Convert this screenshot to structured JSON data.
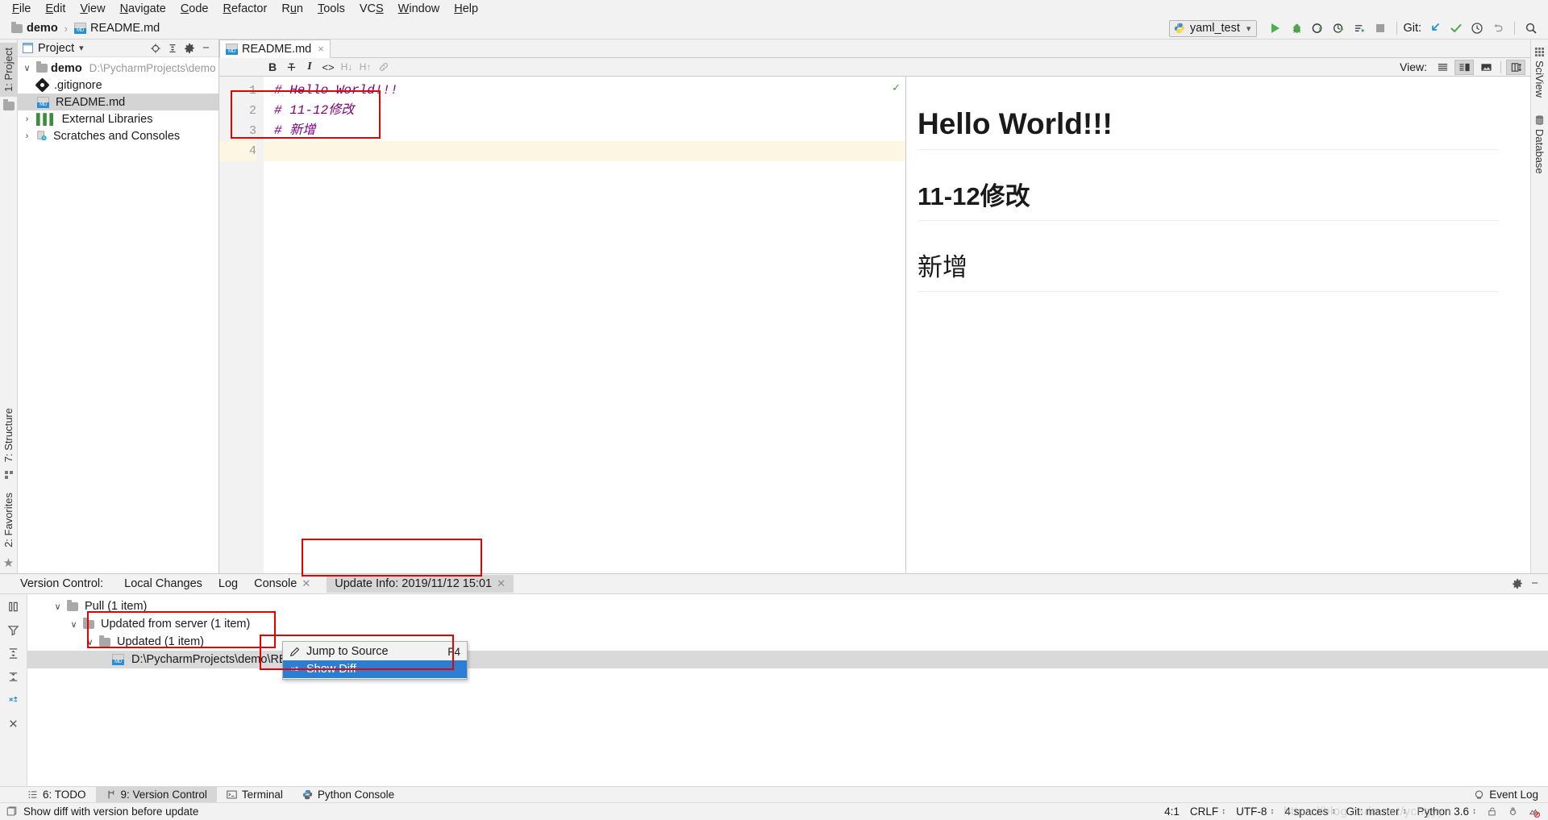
{
  "menubar": {
    "items": [
      {
        "label": "File",
        "accel": "F"
      },
      {
        "label": "Edit",
        "accel": "E"
      },
      {
        "label": "View",
        "accel": "V"
      },
      {
        "label": "Navigate",
        "accel": "N"
      },
      {
        "label": "Code",
        "accel": "C"
      },
      {
        "label": "Refactor",
        "accel": "R"
      },
      {
        "label": "Run",
        "accel": "u"
      },
      {
        "label": "Tools",
        "accel": "T"
      },
      {
        "label": "VCS",
        "accel": "S"
      },
      {
        "label": "Window",
        "accel": "W"
      },
      {
        "label": "Help",
        "accel": "H"
      }
    ]
  },
  "navbar": {
    "breadcrumb": [
      {
        "label": "demo",
        "icon": "folder-icon"
      },
      {
        "label": "README.md",
        "icon": "markdown-file-icon"
      }
    ],
    "separator": "›",
    "run_config": "yaml_test",
    "run_config_icon": "python-icon",
    "dropdown_caret": "⌄",
    "git_label": "Git:",
    "buttons": [
      {
        "name": "run-button",
        "icon": "play-icon"
      },
      {
        "name": "debug-button",
        "icon": "bug-icon"
      },
      {
        "name": "run-coverage-button",
        "icon": "coverage-icon"
      },
      {
        "name": "profile-button",
        "icon": "profile-icon"
      },
      {
        "name": "run-with-button",
        "icon": "run-list-icon"
      },
      {
        "name": "stop-button",
        "icon": "stop-icon"
      },
      {
        "name": "git-update-button",
        "icon": "update-project-icon"
      },
      {
        "name": "git-commit-button",
        "icon": "commit-check-icon"
      },
      {
        "name": "git-history-button",
        "icon": "history-clock-icon"
      },
      {
        "name": "git-rollback-button",
        "icon": "rollback-arrow-icon"
      },
      {
        "name": "search-everywhere-button",
        "icon": "search-icon"
      }
    ]
  },
  "left_strip": {
    "top": [
      {
        "label": "1: Project",
        "selected": true,
        "icon": "folder-icon"
      }
    ],
    "bottom": [
      {
        "label": "7: Structure",
        "selected": false,
        "icon": "structure-icon"
      },
      {
        "label": "2: Favorites",
        "selected": false,
        "icon": "star-icon"
      }
    ]
  },
  "right_strip": {
    "items": [
      {
        "label": "SciView",
        "icon": "grid-icon"
      },
      {
        "label": "Database",
        "icon": "database-icon"
      }
    ]
  },
  "project_panel": {
    "title": "Project",
    "title_caret": "▾",
    "header_icons": [
      {
        "name": "locate-icon"
      },
      {
        "name": "collapse-all-icon"
      },
      {
        "name": "gear-icon"
      },
      {
        "name": "hide-icon"
      }
    ],
    "tree": [
      {
        "indent": 0,
        "twisty": "∨",
        "icon": "folder-icon",
        "label": "demo",
        "bold": true,
        "path": "D:\\PycharmProjects\\demo",
        "selected": false
      },
      {
        "indent": 1,
        "twisty": "",
        "icon": "gitignore-icon",
        "label": ".gitignore",
        "bold": false,
        "path": "",
        "selected": false
      },
      {
        "indent": 1,
        "twisty": "",
        "icon": "markdown-file-icon",
        "label": "README.md",
        "bold": false,
        "path": "",
        "selected": true
      },
      {
        "indent": 0,
        "twisty": "›",
        "icon": "library-icon",
        "label": "External Libraries",
        "bold": false,
        "path": "",
        "selected": false
      },
      {
        "indent": 0,
        "twisty": "›",
        "icon": "scratches-icon",
        "label": "Scratches and Consoles",
        "bold": false,
        "path": "",
        "selected": false
      }
    ]
  },
  "editor": {
    "tab": {
      "label": "README.md",
      "icon": "markdown-file-icon",
      "close": "×"
    },
    "md_toolbar": [
      {
        "name": "bold-button",
        "glyph": "B",
        "dim": false
      },
      {
        "name": "strikethrough-button",
        "glyph": "S",
        "dim": false
      },
      {
        "name": "italic-button",
        "glyph": "I",
        "dim": false
      },
      {
        "name": "code-button",
        "glyph": "<>",
        "dim": false
      },
      {
        "name": "heading-down-button",
        "glyph": "H↓",
        "dim": true
      },
      {
        "name": "heading-up-button",
        "glyph": "H↑",
        "dim": true
      },
      {
        "name": "link-button",
        "glyph": "⚭",
        "dim": true
      }
    ],
    "view_label": "View:",
    "view_buttons": [
      {
        "name": "view-editor-only-button",
        "icon": "lines-icon",
        "active": false
      },
      {
        "name": "view-split-button",
        "icon": "split-icon",
        "active": true
      },
      {
        "name": "view-preview-only-button",
        "icon": "preview-icon",
        "active": false
      },
      {
        "name": "view-toggle-layout-button",
        "icon": "layout-toggle-icon",
        "active": true
      }
    ],
    "lines": [
      {
        "number": "1",
        "text": "# Hello World!!!",
        "current": false
      },
      {
        "number": "2",
        "text": "# 11-12修改",
        "current": false
      },
      {
        "number": "3",
        "text": "# 新增",
        "current": false
      },
      {
        "number": "4",
        "text": "",
        "current": true
      }
    ],
    "inspection_status": "✓",
    "code_color": "#800080"
  },
  "preview": {
    "blocks": [
      {
        "level": "h1",
        "text": "Hello World!!!",
        "weight": "bold"
      },
      {
        "level": "h1",
        "text": "11-12修改",
        "weight": "bold"
      },
      {
        "level": "h1",
        "text": "新增",
        "weight": "normal"
      }
    ]
  },
  "version_control": {
    "label": "Version Control:",
    "tabs": [
      {
        "label": "Local Changes",
        "selected": false,
        "closable": false
      },
      {
        "label": "Log",
        "selected": false,
        "closable": false
      },
      {
        "label": "Console",
        "selected": false,
        "closable": true
      },
      {
        "label": "Update Info: 2019/11/12 15:01",
        "selected": true,
        "closable": true
      }
    ],
    "header_icons": [
      {
        "name": "gear-icon"
      },
      {
        "name": "hide-icon"
      }
    ],
    "side_icons": [
      {
        "name": "group-by-icon"
      },
      {
        "name": "filter-icon"
      },
      {
        "name": "expand-all-icon"
      },
      {
        "name": "collapse-all-icon"
      },
      {
        "name": "show-diff-icon"
      },
      {
        "name": "close-icon"
      }
    ],
    "tree": [
      {
        "indent": 0,
        "twisty": "∨",
        "icon": "folder-icon",
        "label": "Pull (1 item)",
        "selected": false
      },
      {
        "indent": 1,
        "twisty": "∨",
        "icon": "folder-icon",
        "label": "Updated from server (1 item)",
        "selected": false
      },
      {
        "indent": 2,
        "twisty": "∨",
        "icon": "folder-icon",
        "label": "Updated (1 item)",
        "selected": false
      },
      {
        "indent": 3,
        "twisty": "",
        "icon": "markdown-file-icon",
        "label": "D:\\PycharmProjects\\demo\\README.md",
        "selected": true
      }
    ],
    "context_menu": [
      {
        "label": "Jump to Source",
        "shortcut": "F4",
        "icon": "pencil-icon",
        "highlighted": false
      },
      {
        "label": "Show Diff",
        "shortcut": "",
        "icon": "diff-icon",
        "highlighted": true
      }
    ]
  },
  "bottom_tabs": {
    "items": [
      {
        "label": "6: TODO",
        "accel": "6",
        "icon": "todo-icon",
        "selected": false
      },
      {
        "label": "9: Version Control",
        "accel": "9",
        "icon": "vcs-branch-icon",
        "selected": true
      },
      {
        "label": "Terminal",
        "accel": "",
        "icon": "terminal-icon",
        "selected": false
      },
      {
        "label": "Python Console",
        "accel": "",
        "icon": "python-icon",
        "selected": false
      }
    ],
    "event_log": {
      "label": "Event Log",
      "icon": "event-log-icon"
    }
  },
  "statusbar": {
    "left_icon": "diff-window-icon",
    "message": "Show diff with version before update",
    "watermark": "https://blog.csdn.net/ychgyyn",
    "right": [
      {
        "name": "caret-position",
        "label": "4:1",
        "spinner": false
      },
      {
        "name": "line-separator",
        "label": "CRLF",
        "spinner": true
      },
      {
        "name": "file-encoding",
        "label": "UTF-8",
        "spinner": true
      },
      {
        "name": "indent-size",
        "label": "4 spaces",
        "spinner": true
      },
      {
        "name": "git-branch",
        "label": "Git: master",
        "spinner": true
      },
      {
        "name": "python-interpreter",
        "label": "Python 3.6",
        "spinner": true
      }
    ],
    "right_icons": [
      {
        "name": "lock-icon"
      },
      {
        "name": "bug-status-icon"
      },
      {
        "name": "inspections-off-icon"
      }
    ]
  },
  "colors": {
    "accent_blue": "#2a7fd4",
    "annotation_red": "#e60000",
    "markdown_purple": "#800080",
    "current_line": "#fdf6e3",
    "selection_gray": "#d4d4d4",
    "chrome_gray": "#f2f2f2"
  }
}
